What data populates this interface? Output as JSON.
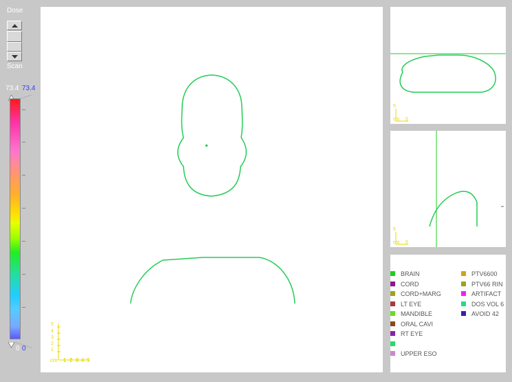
{
  "controls": {
    "dose_label": "Dose",
    "scan_label": "Scan",
    "scale_max_left": "73.4",
    "scale_max_right": "73.4",
    "scale_min_left": "0",
    "scale_min_right": "0"
  },
  "colors": {
    "contour": "#22cc55",
    "crosshair": "#22cc22",
    "scalebar": "#e6d800",
    "max_right_text": "#3a3aff"
  },
  "scalebars": {
    "main": {
      "unit": "cm",
      "x_ticks": [
        "1",
        "2",
        "3",
        "4",
        "5"
      ],
      "y_ticks": [
        "5",
        "4",
        "3",
        "2",
        "1"
      ]
    },
    "small_top": {
      "unit": "cm",
      "x_tick": "5",
      "y_tick": "5"
    },
    "small_mid": {
      "unit": "cm",
      "x_tick": "5",
      "y_tick": "5"
    }
  },
  "legend": {
    "left": [
      {
        "name": "BRAIN",
        "color": "#22cc22"
      },
      {
        "name": "CORD",
        "color": "#8e1a8e"
      },
      {
        "name": "CORD+MARG",
        "color": "#a0a020"
      },
      {
        "name": "LT EYE",
        "color": "#a83a3a"
      },
      {
        "name": "MANDIBLE",
        "color": "#66dd22"
      },
      {
        "name": "ORAL CAVI",
        "color": "#8a4a1a"
      },
      {
        "name": "RT EYE",
        "color": "#8822aa"
      },
      {
        "name": "",
        "color": "#22dd66"
      },
      {
        "name": "UPPER ESO",
        "color": "#cc88cc"
      }
    ],
    "right": [
      {
        "name": "PTV6600",
        "color": "#d4a017"
      },
      {
        "name": "PTV66 RIN",
        "color": "#a0a020"
      },
      {
        "name": "ARTIFACT",
        "color": "#ee22ee"
      },
      {
        "name": "DOS VOL 6",
        "color": "#22dd88"
      },
      {
        "name": "AVOID 42",
        "color": "#3322aa"
      }
    ]
  }
}
